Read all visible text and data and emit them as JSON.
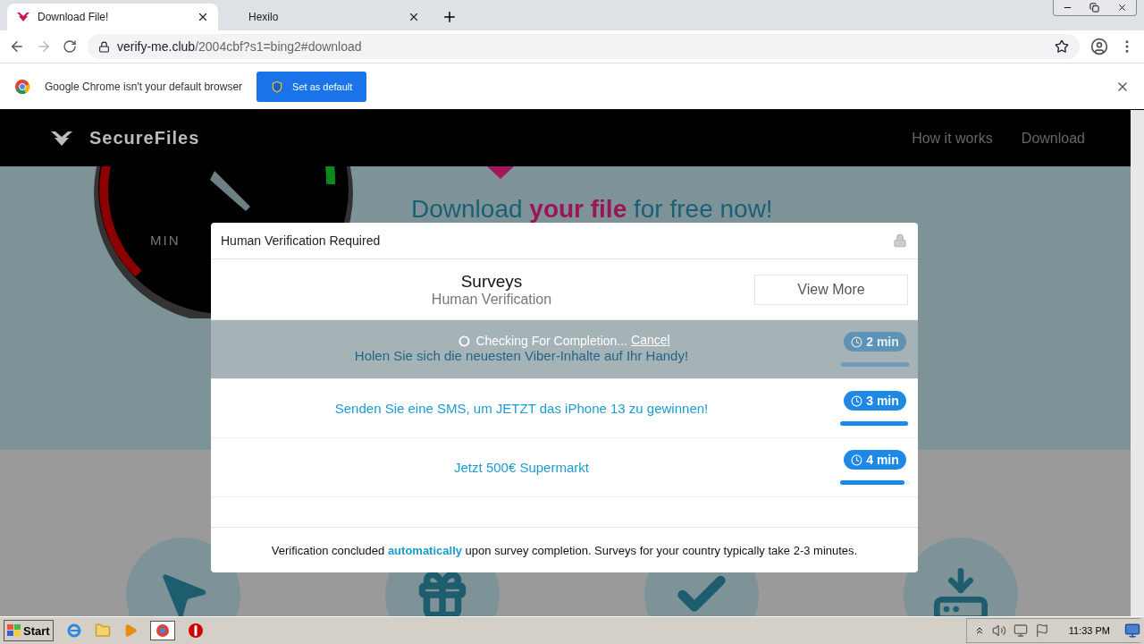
{
  "browser": {
    "tabs": [
      {
        "title": "Download File!",
        "selected": true
      },
      {
        "title": "Hexilo",
        "selected": false
      }
    ],
    "address": {
      "domain": "verify-me.club",
      "path": "/2004cbf?s1=bing2#download"
    },
    "infobar": {
      "message": "Google Chrome isn't your default browser",
      "button": "Set as default"
    }
  },
  "site": {
    "brand": "SecureFiles",
    "nav": [
      "How it works",
      "Download"
    ],
    "gauge_label": "MIN",
    "headline": [
      {
        "text": "Download",
        "kind": "plain"
      },
      {
        "text": "your file",
        "kind": "accent"
      },
      {
        "text": "for free now!",
        "kind": "plain"
      }
    ]
  },
  "modal": {
    "title": "Human Verification Required",
    "heading": "Surveys",
    "subheading": "Human Verification",
    "view_more": "View More",
    "checking": {
      "text": "Checking For Completion...",
      "cancel": "Cancel"
    },
    "surveys": [
      {
        "title": "Holen Sie sich die neuesten Viber-Inhalte auf Ihr Handy!",
        "time": "2 min",
        "level": 1.0,
        "checking": true
      },
      {
        "title": "Senden Sie eine SMS, um JETZT das iPhone 13 zu gewinnen!",
        "time": "3 min",
        "level": 0.98,
        "checking": false
      },
      {
        "title": "Jetzt 500€ Supermarkt",
        "time": "4 min",
        "level": 0.92,
        "checking": false
      }
    ],
    "footer": "Verification concluded **automatically** upon survey completion. Surveys for your country typically take 2-3 minutes."
  },
  "taskbar": {
    "start": "Start",
    "clock": "11:33 PM"
  }
}
